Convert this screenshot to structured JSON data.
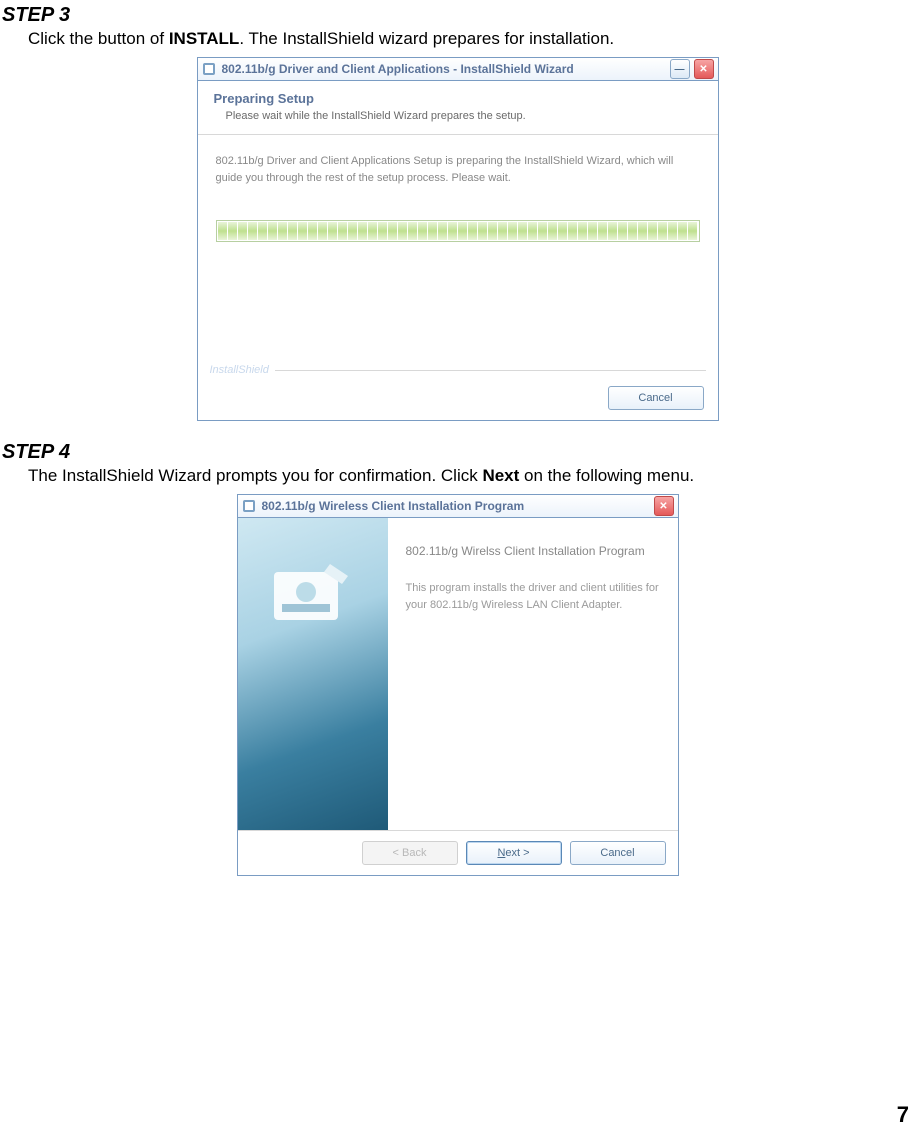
{
  "step3": {
    "heading": "STEP 3",
    "body_prefix": "Click the button of ",
    "body_bold": "INSTALL",
    "body_suffix": ". The InstallShield wizard prepares for installation."
  },
  "step4": {
    "heading": "STEP 4",
    "body_prefix": "The InstallShield Wizard prompts you for confirmation. Click ",
    "body_bold": "Next",
    "body_suffix": " on the following menu."
  },
  "dialog1": {
    "title": "802.11b/g Driver and Client Applications - InstallShield Wizard",
    "header_title": "Preparing Setup",
    "header_sub": "Please wait while the InstallShield Wizard prepares the setup.",
    "message": "802.11b/g Driver and Client Applications Setup is preparing the InstallShield Wizard, which will guide you through the rest of the setup process. Please wait.",
    "brand": "InstallShield",
    "cancel": "Cancel"
  },
  "dialog2": {
    "title": "802.11b/g Wireless Client Installation Program",
    "main_title": "802.11b/g Wirelss Client Installation Program",
    "main_desc": "This program installs the driver and client utilities for your 802.11b/g Wireless LAN Client Adapter.",
    "back": "< Back",
    "next": "Next >",
    "cancel": "Cancel"
  },
  "page_number": "7"
}
